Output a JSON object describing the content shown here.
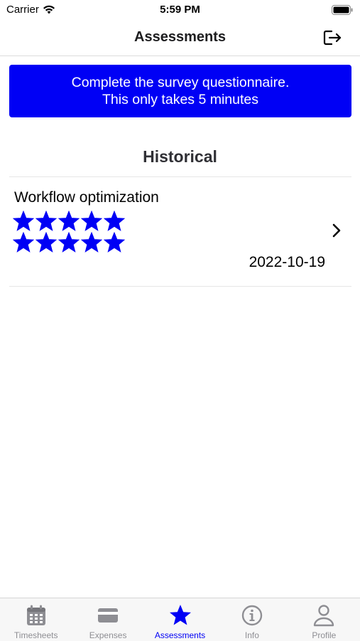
{
  "status_bar": {
    "carrier": "Carrier",
    "time": "5:59 PM"
  },
  "nav": {
    "title": "Assessments",
    "logout_icon": "logout-icon"
  },
  "banner": {
    "line1": "Complete the survey questionnaire.",
    "line2": "This only takes 5 minutes"
  },
  "historical": {
    "heading": "Historical",
    "items": [
      {
        "title": "Workflow optimization",
        "rating": 10,
        "rating_max": 10,
        "date": "2022-10-19"
      }
    ]
  },
  "tabs": [
    {
      "label": "Timesheets",
      "icon": "calendar-icon",
      "active": false
    },
    {
      "label": "Expenses",
      "icon": "credit-card-icon",
      "active": false
    },
    {
      "label": "Assessments",
      "icon": "star-icon",
      "active": true
    },
    {
      "label": "Info",
      "icon": "info-icon",
      "active": false
    },
    {
      "label": "Profile",
      "icon": "person-icon",
      "active": false
    }
  ],
  "colors": {
    "accent": "#0000f5",
    "inactive": "#8e8e93"
  }
}
